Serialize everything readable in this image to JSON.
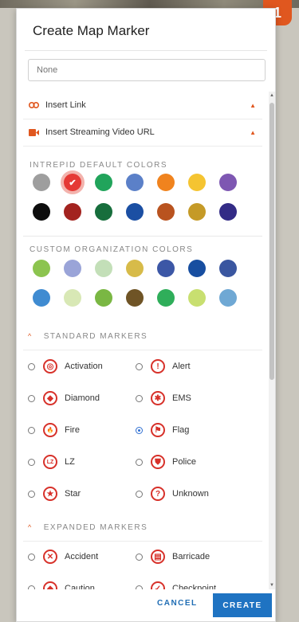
{
  "badge": "1",
  "dialog": {
    "title": "Create Map Marker",
    "name_placeholder": "None"
  },
  "links": {
    "insert_link": "Insert Link",
    "insert_video": "Insert Streaming Video URL"
  },
  "default_colors": {
    "label": "INTREPID DEFAULT COLORS",
    "colors": [
      "#9e9e9e",
      "#e53935",
      "#21a45b",
      "#5b80c8",
      "#f0831e",
      "#f5c431",
      "#7e57b2",
      "#0d0d0d",
      "#a3231f",
      "#176e3c",
      "#1b4fa3",
      "#b9531f",
      "#c59a27",
      "#332b86"
    ],
    "selected_index": 1
  },
  "custom_colors": {
    "label": "CUSTOM ORGANIZATION COLORS",
    "colors": [
      "#8cc44f",
      "#9aa4d8",
      "#c3dfb8",
      "#d7bb49",
      "#3c57a6",
      "#174ea0",
      "#3a56a0",
      "#3f8bd1",
      "#d8e8b5",
      "#7ab743",
      "#6f5426",
      "#2fae5a",
      "#c8df70",
      "#6fa8d4"
    ]
  },
  "standard_markers": {
    "label": "STANDARD MARKERS",
    "items": [
      {
        "label": "Activation",
        "icon": "target-icon",
        "glyph": "◎",
        "checked": false
      },
      {
        "label": "Alert",
        "icon": "exclamation-icon",
        "glyph": "!",
        "checked": false
      },
      {
        "label": "Diamond",
        "icon": "diamond-icon",
        "glyph": "◆",
        "checked": false
      },
      {
        "label": "EMS",
        "icon": "star-of-life-icon",
        "glyph": "✱",
        "checked": false
      },
      {
        "label": "Fire",
        "icon": "flame-icon",
        "glyph": "🔥",
        "checked": false
      },
      {
        "label": "Flag",
        "icon": "flag-icon",
        "glyph": "⚑",
        "checked": true
      },
      {
        "label": "LZ",
        "icon": "lz-icon",
        "glyph": "LZ",
        "checked": false
      },
      {
        "label": "Police",
        "icon": "shield-icon",
        "glyph": "⛊",
        "checked": false
      },
      {
        "label": "Star",
        "icon": "star-icon",
        "glyph": "★",
        "checked": false
      },
      {
        "label": "Unknown",
        "icon": "question-icon",
        "glyph": "?",
        "checked": false
      }
    ]
  },
  "expanded_markers": {
    "label": "EXPANDED MARKERS",
    "items": [
      {
        "label": "Accident",
        "icon": "accident-icon",
        "glyph": "✕",
        "checked": false
      },
      {
        "label": "Barricade",
        "icon": "barricade-icon",
        "glyph": "▤",
        "checked": false
      },
      {
        "label": "Caution",
        "icon": "caution-icon",
        "glyph": "◆",
        "checked": false
      },
      {
        "label": "Checkpoint",
        "icon": "checkpoint-icon",
        "glyph": "✓",
        "checked": false
      }
    ]
  },
  "footer": {
    "cancel": "CANCEL",
    "create": "CREATE"
  },
  "accent_color": "#e0571f",
  "marker_color": "#d7312a"
}
